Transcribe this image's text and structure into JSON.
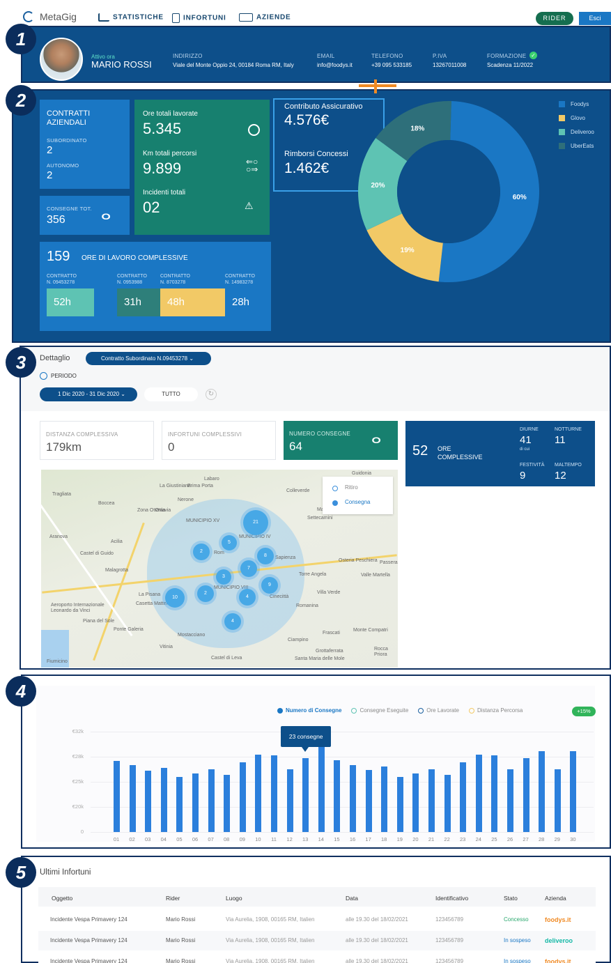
{
  "nav": {
    "logo": "MetaGig",
    "statistiche": "STATISTICHE",
    "infortuni": "INFORTUNI",
    "aziende": "AZIENDE",
    "rider_btn": "RIDER",
    "esci_btn": "Esci"
  },
  "badges": [
    "1",
    "2",
    "3",
    "4",
    "5"
  ],
  "profile": {
    "status": "Attivo ora",
    "name": "MARIO ROSSI",
    "address_label": "INDIRIZZO",
    "address": "Viale del Monte Oppio 24, 00184 Roma RM, Italy",
    "email_label": "EMAIL",
    "email": "info@foodys.it",
    "phone_label": "TELEFONO",
    "phone": "+39 095 533185",
    "piva_label": "P.IVA",
    "piva": "13267011008",
    "formazione_label": "FORMAZIONE",
    "formazione": "Scadenza 11/2022"
  },
  "stats": {
    "contratti_title": "CONTRATTI AZIENDALI",
    "subordinato_label": "SUBORDINATO",
    "subordinato": "2",
    "autonomo_label": "AUTONOMO",
    "autonomo": "2",
    "consegne_label": "CONSEGNE TOT.",
    "consegne": "356",
    "ore_label": "Ore totali lavorate",
    "ore": "5.345",
    "km_label": "Km totali percorsi",
    "km": "9.899",
    "incidenti_label": "Incidenti totali",
    "incidenti": "02",
    "contributo_label": "Contributo Assicurativo",
    "contributo": "4.576€",
    "rimborsi_label": "Rimborsi Concessi",
    "rimborsi": "1.462€",
    "ore_complessive_num": "159",
    "ore_complessive_label": "ORE DI LAVORO COMPLESSIVE",
    "contracts": [
      {
        "label": "CONTRATTO",
        "num": "N. 09453278",
        "hours": "52h",
        "color": "#5ec3b3"
      },
      {
        "label": "CONTRATTO",
        "num": "N. 0953988",
        "hours": "31h",
        "color": "#2e7f7a"
      },
      {
        "label": "CONTRATTO",
        "num": "N. 8703278",
        "hours": "48h",
        "color": "#f2c966"
      },
      {
        "label": "CONTRATTO",
        "num": "N. 14983278",
        "hours": "28h",
        "color": "#1a77c4"
      }
    ]
  },
  "chart_data": [
    {
      "type": "pie",
      "title": "",
      "series": [
        {
          "name": "Foodys",
          "value": 60,
          "color": "#1a77c4"
        },
        {
          "name": "Glovo",
          "value": 19,
          "color": "#f2c966"
        },
        {
          "name": "Deliveroo",
          "value": 20,
          "color": "#5ec3b3"
        },
        {
          "name": "UberEats",
          "value": 18,
          "color": "#2e6f7a"
        }
      ],
      "labels": [
        "60%",
        "19%",
        "20%",
        "18%"
      ],
      "legend": "top-right"
    },
    {
      "type": "bar",
      "title": "",
      "categories": [
        "01",
        "02",
        "03",
        "04",
        "05",
        "06",
        "07",
        "08",
        "09",
        "10",
        "11",
        "12",
        "13",
        "14",
        "15",
        "16",
        "17",
        "18",
        "19",
        "20",
        "21",
        "22",
        "23",
        "24",
        "25",
        "26",
        "27",
        "28",
        "29",
        "30"
      ],
      "values": [
        27.5,
        27,
        26.3,
        26.7,
        25.6,
        26,
        26.5,
        25.8,
        27.3,
        28.3,
        28.2,
        26.5,
        27.8,
        29.6,
        27.6,
        27,
        26.4,
        26.8,
        25.6,
        26,
        26.5,
        25.8,
        27.3,
        28.3,
        28.2,
        26.5,
        27.8,
        28.9,
        26.5,
        28.9
      ],
      "yticks": [
        "0",
        "€20k",
        "€25k",
        "€28k",
        "€32k"
      ],
      "legend": [
        "Numero di Consegne",
        "Consegne Eseguite",
        "Ore Lavorate",
        "Distanza Percorsa"
      ],
      "tooltip": "23 consegne",
      "growth": "+15%",
      "legend_position": "top"
    }
  ],
  "pie_legend": [
    "Foodys",
    "Glovo",
    "Deliveroo",
    "UberEats"
  ],
  "detail": {
    "title": "Dettaglio",
    "contract_select": "Contratto Subordinato N.09453278",
    "periodo_label": "PERIODO",
    "date_range": "1 Dic 2020 - 31 Dic 2020",
    "tutto": "TUTTO",
    "distanza_label": "DISTANZA COMPLESSIVA",
    "distanza": "179km",
    "infortuni_label": "INFORTUNI COMPLESSIVI",
    "infortuni": "0",
    "numero_label": "NUMERO CONSEGNE",
    "numero": "64",
    "ore_num": "52",
    "ore_label": "ORE COMPLESSIVE",
    "diurne_label": "DIURNE",
    "diurne": "41",
    "notturne_label": "NOTTURNE",
    "notturne": "11",
    "dicui": "di cui",
    "festivita_label": "FESTIVITÀ",
    "festivita": "9",
    "maltempo_label": "MALTEMPO",
    "maltempo": "12",
    "map_legend_ritiro": "Ritiro",
    "map_legend_consegna": "Consegna",
    "map_places": [
      "Tragliata",
      "Boccea",
      "Aranova",
      "Castel di Guido",
      "Malagrotta",
      "Aeroporto Internazionale Leonardo da Vinci",
      "Fiumicino",
      "Rom",
      "MUNICIPIO XV",
      "MUNICIPIO IV",
      "MUNICIPIO VIII",
      "Sapienza",
      "Frascati",
      "Grottaferrata",
      "Ciampino",
      "Vitinia",
      "La Pisana",
      "Casetta Mattei",
      "Monte Compatri",
      "Rocca Priora",
      "Valle Martella",
      "Osteria Peschiera",
      "Colleverde",
      "Settecamini",
      "Marco Simone",
      "Guidonia",
      "Romanina",
      "Torre Angela",
      "Cinecittà",
      "Villa Verde",
      "Passerano",
      "Acilia",
      "Santa Maria delle Mole",
      "Ponte Galeria",
      "Piana del Sole",
      "Mostacciano",
      "Castel di Leva",
      "Labaro",
      "Ottavia",
      "Prima Porta",
      "La Giustiniana",
      "Nerone",
      "Zona Ottavia",
      "Corcolle"
    ],
    "map_markers": [
      "21",
      "5",
      "2",
      "8",
      "7",
      "3",
      "2",
      "9",
      "4",
      "10",
      "4"
    ]
  },
  "table": {
    "title": "Ultimi Infortuni",
    "headers": [
      "Oggetto",
      "Rider",
      "Luogo",
      "Data",
      "Identificativo",
      "Stato",
      "Azienda"
    ],
    "rows": [
      {
        "oggetto": "Incidente Vespa Primavery 124",
        "rider": "Mario Rossi",
        "luogo": "Via Aurelia, 1908, 00165 RM, Italien",
        "data": "alle 19.30 del 18/02/2021",
        "id": "123456789",
        "stato": "Concesso",
        "azienda": "foodys.it",
        "stato_color": "#2aa86e",
        "azienda_color": "#f08a24"
      },
      {
        "oggetto": "Incidente Vespa Primavery 124",
        "rider": "Mario Rossi",
        "luogo": "Via Aurelia, 1908, 00165 RM, Italien",
        "data": "alle 19.30 del 18/02/2021",
        "id": "123456789",
        "stato": "In sospeso",
        "azienda": "deliveroo",
        "stato_color": "#1a77c4",
        "azienda_color": "#14b8a6"
      },
      {
        "oggetto": "Incidente Vespa Primavery 124",
        "rider": "Mario Rossi",
        "luogo": "Via Aurelia, 1908, 00165 RM, Italien",
        "data": "alle 19.30 del 18/02/2021",
        "id": "123456789",
        "stato": "In sospeso",
        "azienda": "foodys.it",
        "stato_color": "#1a77c4",
        "azienda_color": "#f08a24"
      }
    ]
  }
}
